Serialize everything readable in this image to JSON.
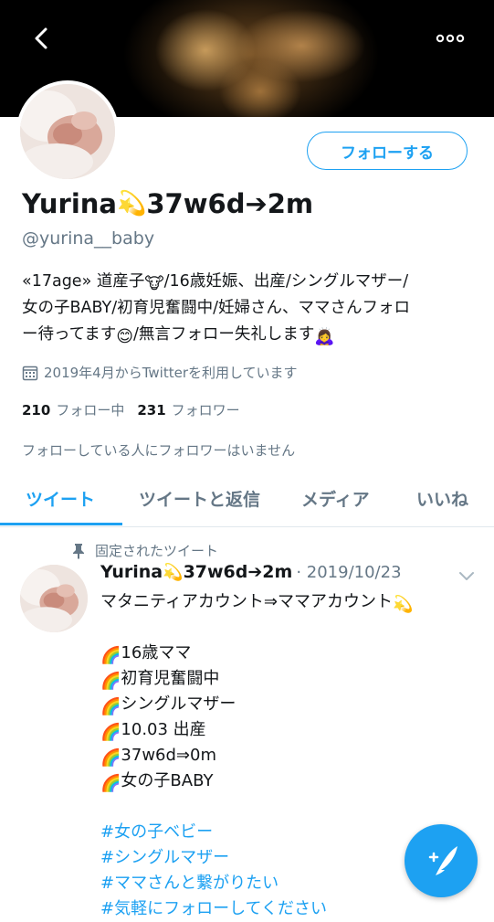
{
  "header": {
    "back_icon": "chevron-left-icon",
    "more_icon": "ellipsis-icon"
  },
  "profile": {
    "follow_label": "フォローする",
    "display_name": "Yurina",
    "display_name_suffix": "37w6d➔2m",
    "name_emoji": "💫",
    "handle": "@yurina__baby",
    "bio_line1_a": "«17age» 道産子",
    "bio_line1_emoji": "🐮",
    "bio_line1_b": "/16歳妊娠、出産/シングルマザー/",
    "bio_line2": "女の子BABY/初育児奮闘中/妊婦さん、ママさんフォロ",
    "bio_line3_a": "ー待ってます",
    "bio_line3_emoji_a": "😊",
    "bio_line3_b": "/無言フォロー失礼します",
    "bio_line3_emoji_b": "🙇‍♀️",
    "joined": "2019年4月からTwitterを利用しています",
    "following_count": "210",
    "following_label": "フォロー中",
    "followers_count": "231",
    "followers_label": "フォロワー",
    "followers_known": "フォローしている人にフォロワーはいません"
  },
  "tabs": [
    {
      "label": "ツイート",
      "active": true
    },
    {
      "label": "ツイートと返信",
      "active": false
    },
    {
      "label": "メディア",
      "active": false
    },
    {
      "label": "いいね",
      "active": false
    }
  ],
  "tweet": {
    "pinned_label": "固定されたツイート",
    "author_name": "Yurina",
    "author_suffix": "37w6d➔2m",
    "author_emoji": "💫",
    "date": "· 2019/10/23",
    "line1": "マタニティアカウント⇒ママアカウント",
    "line1_emoji": "💫",
    "rainbow_emoji": "🌈",
    "list": [
      "16歳ママ",
      "初育児奮闘中",
      "シングルマザー",
      "10.03 出産",
      "37w6d⇒0m",
      "女の子BABY"
    ],
    "hashtags": [
      "#女の子ベビー",
      "#シングルマザー",
      "#ママさんと繋がりたい",
      "#気軽にフォローしてください"
    ]
  },
  "fab": {
    "icon": "compose-feather-icon"
  },
  "colors": {
    "accent": "#1da1f2",
    "secondary_text": "#657786",
    "primary_text": "#14171a"
  }
}
